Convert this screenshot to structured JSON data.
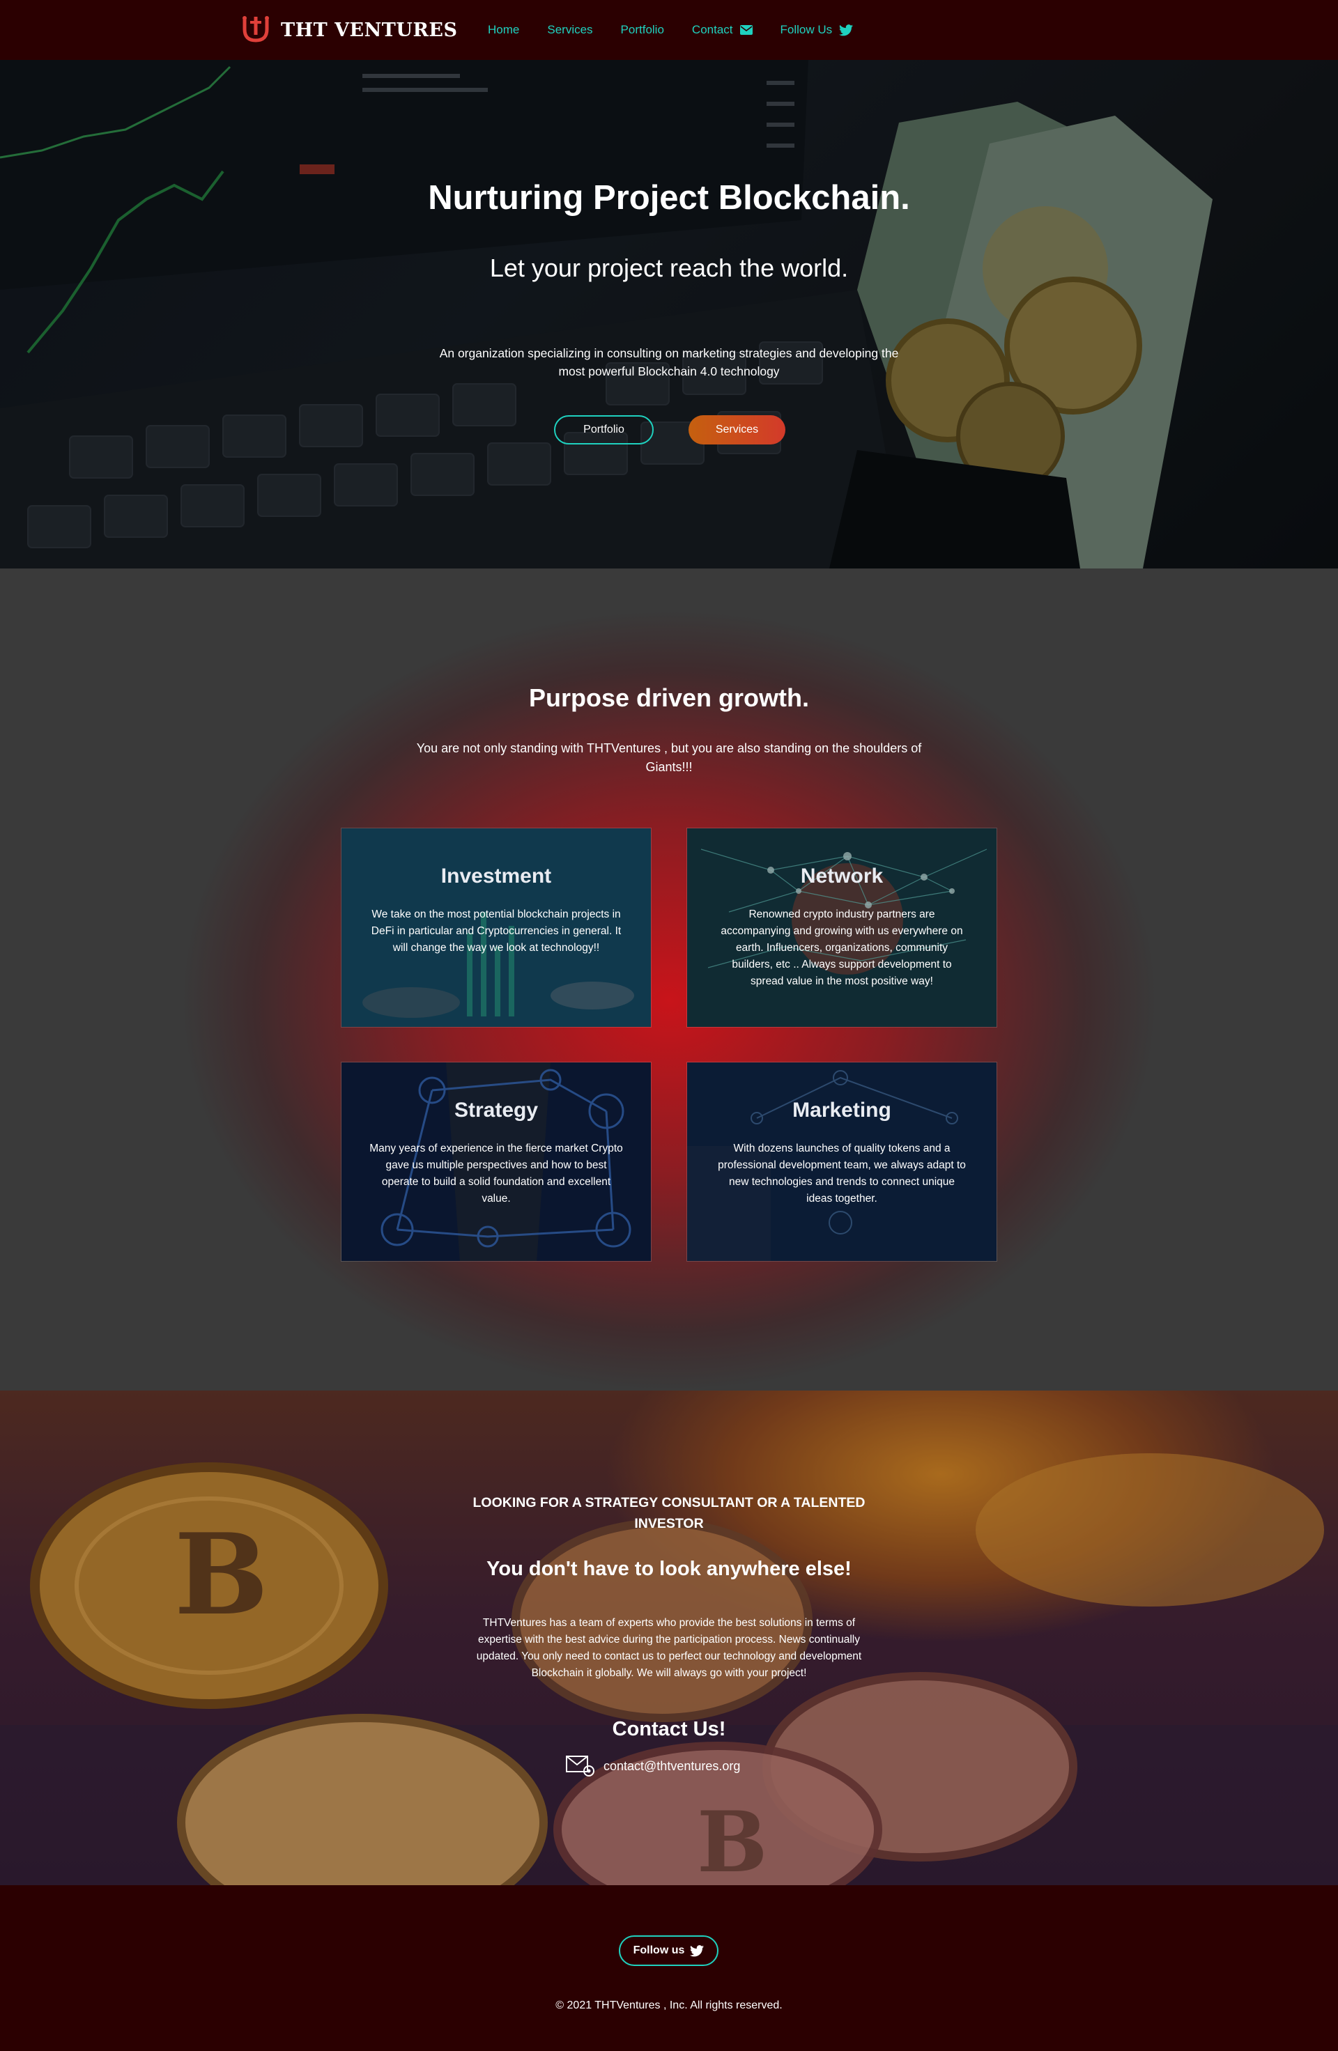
{
  "nav": {
    "brand": "THT VENTURES",
    "items": [
      {
        "label": "Home"
      },
      {
        "label": "Services"
      },
      {
        "label": "Portfolio"
      },
      {
        "label": "Contact",
        "icon": "envelope-icon"
      },
      {
        "label": "Follow Us",
        "icon": "twitter-icon"
      }
    ]
  },
  "hero": {
    "title": "Nurturing Project Blockchain.",
    "subtitle": "Let your project reach the world.",
    "description": "An organization specializing in consulting on marketing strategies and developing the most powerful Blockchain 4.0 technology",
    "portfolio_label": "Portfolio",
    "services_label": "Services"
  },
  "purpose": {
    "title": "Purpose driven growth.",
    "description": "You are not only standing with THTVentures , but you are also standing on the shoulders of Giants!!!",
    "cards": [
      {
        "title": "Investment",
        "text": "We take on the most potential blockchain projects in DeFi in particular and Cryptocurrencies in general. It will change the way we look at technology!!"
      },
      {
        "title": "Network",
        "text": "Renowned crypto industry partners are accompanying and growing with us everywhere on earth. Influencers, organizations, community builders, etc .. Always support development to spread value in the most positive way!"
      },
      {
        "title": "Strategy",
        "text": "Many years of experience in the fierce market Crypto gave us multiple perspectives and how to best operate to build a solid foundation and excellent value."
      },
      {
        "title": "Marketing",
        "text": "With dozens launches of quality tokens and a professional development team, we always adapt to new technologies and trends to connect unique ideas together."
      }
    ]
  },
  "cta": {
    "kicker": "LOOKING FOR A STRATEGY CONSULTANT OR A TALENTED INVESTOR",
    "title": "You don't have to look anywhere else!",
    "description": "THTVentures has a team of experts who provide the best solutions in terms of expertise with the best advice during the participation process. News continually updated. You only need to contact us to perfect our technology and development Blockchain it globally. We will always go with your project!",
    "contact_title": "Contact Us!",
    "email": "contact@thtventures.org"
  },
  "footer": {
    "follow_label": "Follow us",
    "copyright": "© 2021 THTVentures , Inc. All rights reserved."
  },
  "colors": {
    "accent": "#1fd1bf",
    "nav_bg": "#2b0001",
    "brand_red": "#e0403a",
    "services_btn": "#d0462a"
  }
}
